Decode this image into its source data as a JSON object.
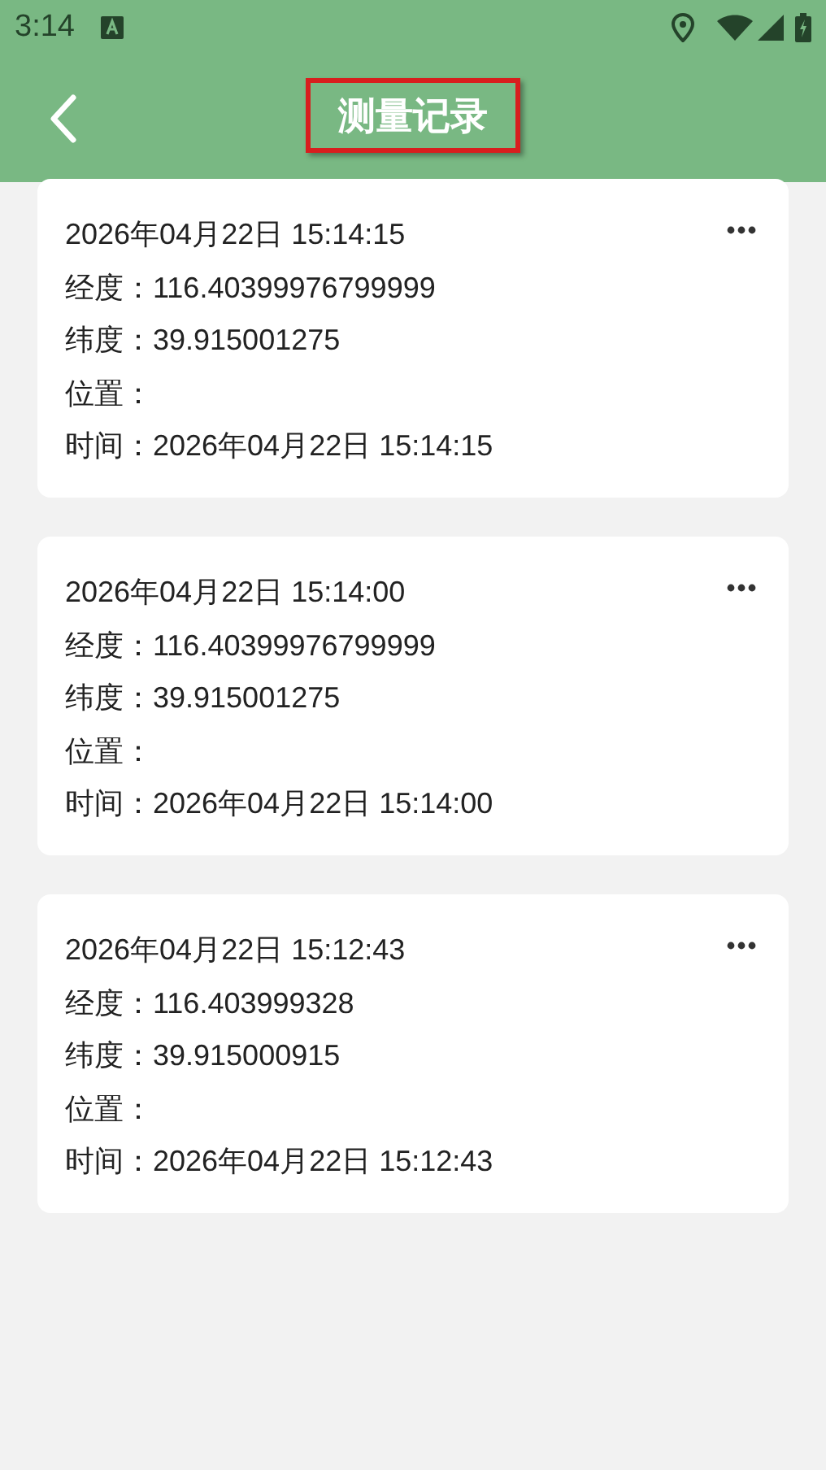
{
  "status_bar": {
    "time": "3:14"
  },
  "app_bar": {
    "title": "测量记录",
    "title_highlighted": true
  },
  "records": [
    {
      "heading": "2026年04月22日 15:14:15",
      "lines": [
        "经度：116.40399976799999",
        "纬度：39.915001275",
        "位置：",
        "时间：2026年04月22日 15:14:15"
      ]
    },
    {
      "heading": "2026年04月22日 15:14:00",
      "lines": [
        "经度：116.40399976799999",
        "纬度：39.915001275",
        "位置：",
        "时间：2026年04月22日 15:14:00"
      ]
    },
    {
      "heading": "2026年04月22日 15:12:43",
      "lines": [
        "经度：116.403999328",
        "纬度：39.915000915",
        "位置：",
        "时间：2026年04月22日 15:12:43"
      ]
    }
  ]
}
